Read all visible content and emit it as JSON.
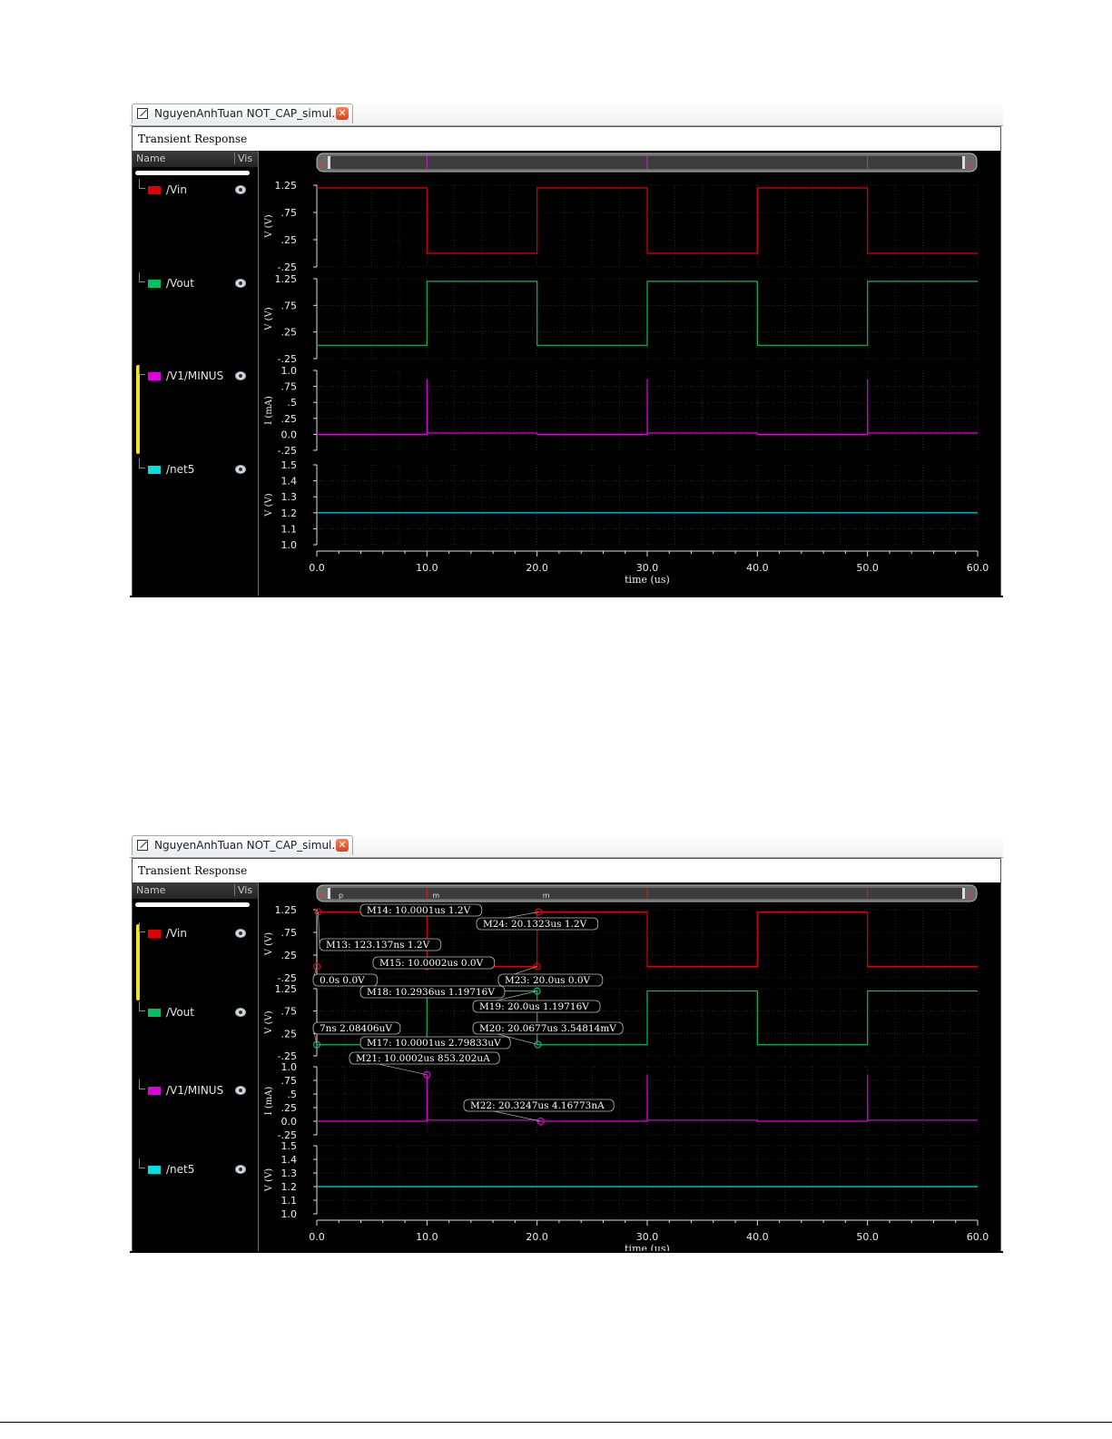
{
  "windows": [
    {
      "tab_title": "NguyenAnhTuan NOT_CAP_simul...",
      "close_glyph": "✕",
      "panel_title": "Transient Response",
      "sidebar_header": {
        "name": "Name",
        "vis": "Vis"
      },
      "signals": [
        {
          "name": "/Vin",
          "color": "#e00000"
        },
        {
          "name": "/Vout",
          "color": "#00c060"
        },
        {
          "name": "/V1/MINUS",
          "color": "#e000e0"
        },
        {
          "name": "/net5",
          "color": "#00e0e0"
        }
      ],
      "selected_signal": "/V1/MINUS",
      "markers": []
    },
    {
      "tab_title": "NguyenAnhTuan NOT_CAP_simul...",
      "close_glyph": "✕",
      "panel_title": "Transient Response",
      "sidebar_header": {
        "name": "Name",
        "vis": "Vis"
      },
      "signals": [
        {
          "name": "/Vin",
          "color": "#e00000"
        },
        {
          "name": "/Vout",
          "color": "#00c060"
        },
        {
          "name": "/V1/MINUS",
          "color": "#e000e0"
        },
        {
          "name": "/net5",
          "color": "#00e0e0"
        }
      ],
      "selected_signal": "/Vin",
      "markers": [
        {
          "label": "M14: 10.0001us 1.2V",
          "strip": 0,
          "x": 10.0001,
          "y": 1.2
        },
        {
          "label": "M24: 20.1323us 1.2V",
          "strip": 0,
          "x": 20.1323,
          "y": 1.2
        },
        {
          "label": "M13: 123.137ns 1.2V",
          "strip": 0,
          "x": 0.123137,
          "y": 1.2
        },
        {
          "label": "M15: 10.0002us 0.0V",
          "strip": 0,
          "x": 10.0002,
          "y": 0.0
        },
        {
          "label": "0.0s 0.0V",
          "strip": 0,
          "x": 0.0,
          "y": 0.0
        },
        {
          "label": "M23: 20.0us 0.0V",
          "strip": 0,
          "x": 20.0,
          "y": 0.0
        },
        {
          "label": "M18: 10.2936us 1.19716V",
          "strip": 1,
          "x": 10.2936,
          "y": 1.19716
        },
        {
          "label": "M19: 20.0us 1.19716V",
          "strip": 1,
          "x": 20.0,
          "y": 1.19716
        },
        {
          "label": "7ns 2.08406uV",
          "strip": 1,
          "x": 0.0,
          "y": 0.0
        },
        {
          "label": "M20: 20.0677us 3.54814mV",
          "strip": 1,
          "x": 20.0677,
          "y": 0.0035
        },
        {
          "label": "M17: 10.0001us 2.79833uV",
          "strip": 1,
          "x": 10.0001,
          "y": 0.0
        },
        {
          "label": "M21: 10.0002us 853.202uA",
          "strip": 2,
          "x": 10.0002,
          "y": 0.853202
        },
        {
          "label": "M22: 20.3247us 4.16773nA",
          "strip": 2,
          "x": 20.3247,
          "y": 0.0
        }
      ],
      "scroll_tags": [
        "p",
        "m",
        "m"
      ]
    }
  ],
  "chart_data": {
    "type": "line",
    "xlabel": "time (us)",
    "xlim": [
      0,
      60
    ],
    "x_ticks": [
      "0.0",
      "10.0",
      "20.0",
      "30.0",
      "40.0",
      "50.0",
      "60.0"
    ],
    "strips": [
      {
        "series": "/Vin",
        "ylabel": "V (V)",
        "ylim": [
          -0.25,
          1.25
        ],
        "y_ticks": [
          {
            "v": 1.25,
            "t": "1.25"
          },
          {
            "v": 0.75,
            "t": ".75"
          },
          {
            "v": 0.25,
            "t": ".25"
          },
          {
            "v": -0.25,
            "t": "-.25"
          }
        ],
        "points": [
          [
            0,
            1.2
          ],
          [
            10,
            1.2
          ],
          [
            10,
            0
          ],
          [
            20,
            0
          ],
          [
            20,
            1.2
          ],
          [
            30,
            1.2
          ],
          [
            30,
            0
          ],
          [
            40,
            0
          ],
          [
            40,
            1.2
          ],
          [
            50,
            1.2
          ],
          [
            50,
            0
          ],
          [
            60,
            0
          ]
        ]
      },
      {
        "series": "/Vout",
        "ylabel": "V (V)",
        "ylim": [
          -0.25,
          1.25
        ],
        "y_ticks": [
          {
            "v": 1.25,
            "t": "1.25"
          },
          {
            "v": 0.75,
            "t": ".75"
          },
          {
            "v": 0.25,
            "t": ".25"
          },
          {
            "v": -0.25,
            "t": "-.25"
          }
        ],
        "points": [
          [
            0,
            0
          ],
          [
            10,
            0
          ],
          [
            10,
            1.2
          ],
          [
            20,
            1.2
          ],
          [
            20,
            0
          ],
          [
            30,
            0
          ],
          [
            30,
            1.2
          ],
          [
            40,
            1.2
          ],
          [
            40,
            0
          ],
          [
            50,
            0
          ],
          [
            50,
            1.2
          ],
          [
            60,
            1.2
          ]
        ]
      },
      {
        "series": "/V1/MINUS",
        "ylabel": "I (mA)",
        "ylim": [
          -0.25,
          1.0
        ],
        "y_ticks": [
          {
            "v": 1.0,
            "t": "1.0"
          },
          {
            "v": 0.75,
            "t": ".75"
          },
          {
            "v": 0.5,
            "t": ".5"
          },
          {
            "v": 0.25,
            "t": ".25"
          },
          {
            "v": 0.0,
            "t": "0.0"
          },
          {
            "v": -0.25,
            "t": "-.25"
          }
        ],
        "points": [
          [
            0,
            0
          ],
          [
            10,
            0
          ],
          [
            10,
            0.86
          ],
          [
            10.02,
            0.02
          ],
          [
            20,
            0.02
          ],
          [
            20,
            0
          ],
          [
            30,
            0
          ],
          [
            30,
            0.86
          ],
          [
            30.02,
            0.02
          ],
          [
            40,
            0.02
          ],
          [
            40,
            0
          ],
          [
            50,
            0
          ],
          [
            50,
            0.86
          ],
          [
            50.02,
            0.02
          ],
          [
            60,
            0.02
          ]
        ]
      },
      {
        "series": "/net5",
        "ylabel": "V (V)",
        "ylim": [
          1.0,
          1.5
        ],
        "y_ticks": [
          {
            "v": 1.5,
            "t": "1.5"
          },
          {
            "v": 1.4,
            "t": "1.4"
          },
          {
            "v": 1.3,
            "t": "1.3"
          },
          {
            "v": 1.2,
            "t": "1.2"
          },
          {
            "v": 1.1,
            "t": "1.1"
          },
          {
            "v": 1.0,
            "t": "1.0"
          }
        ],
        "points": [
          [
            0,
            1.2
          ],
          [
            60,
            1.2
          ]
        ]
      }
    ]
  }
}
